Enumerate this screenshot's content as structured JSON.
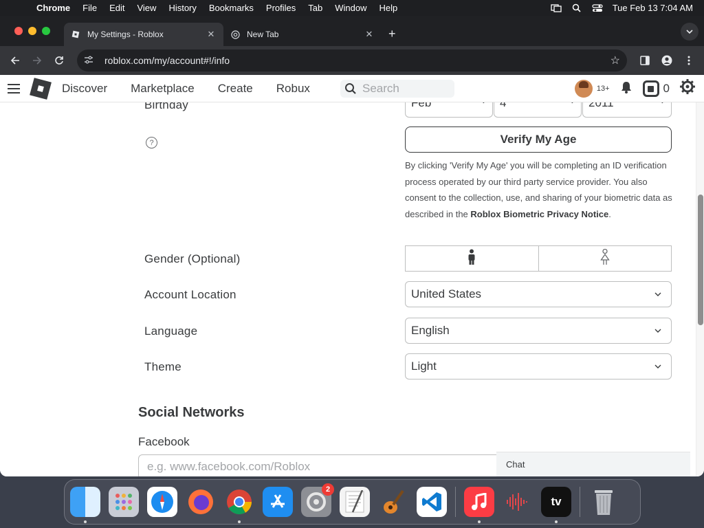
{
  "menubar": {
    "app": "Chrome",
    "items": [
      "File",
      "Edit",
      "View",
      "History",
      "Bookmarks",
      "Profiles",
      "Tab",
      "Window",
      "Help"
    ],
    "clock": "Tue Feb 13  7:04 AM"
  },
  "browser": {
    "tabs": [
      {
        "title": "My Settings - Roblox"
      },
      {
        "title": "New Tab"
      }
    ],
    "new_tab_glyph": "+",
    "url": "roblox.com/my/account#!/info"
  },
  "roblox_header": {
    "nav": [
      "Discover",
      "Marketplace",
      "Create",
      "Robux"
    ],
    "search_placeholder": "Search",
    "age_badge": "13+",
    "robux_count": "0"
  },
  "settings": {
    "birthday_label": "Birthday",
    "birthday": {
      "month": "Feb",
      "day": "4",
      "year": "2011"
    },
    "help_glyph": "?",
    "verify_button": "Verify My Age",
    "verify_text_pre": "By clicking 'Verify My Age' you will be completing an ID verification process operated by our third party service provider. You also consent to the collection, use, and sharing of your biometric data as described in the ",
    "verify_text_link": "Roblox Biometric Privacy Notice",
    "verify_text_post": ".",
    "gender_label": "Gender (Optional)",
    "location_label": "Account Location",
    "location_value": "United States",
    "language_label": "Language",
    "language_value": "English",
    "theme_label": "Theme",
    "theme_value": "Light",
    "social_title": "Social Networks",
    "facebook_label": "Facebook",
    "facebook_placeholder": "e.g. www.facebook.com/Roblox"
  },
  "chat_label": "Chat",
  "dock": {
    "apps": [
      "finder-icon",
      "launchpad-icon",
      "safari-icon",
      "firefox-icon",
      "chrome-icon",
      "app-store-icon",
      "system-settings-icon",
      "textedit-icon",
      "garageband-icon",
      "vscode-icon",
      "music-icon",
      "voice-memos-icon",
      "apple-tv-icon",
      "trash-icon"
    ],
    "settings_badge": "2",
    "tv_label": "tv"
  }
}
